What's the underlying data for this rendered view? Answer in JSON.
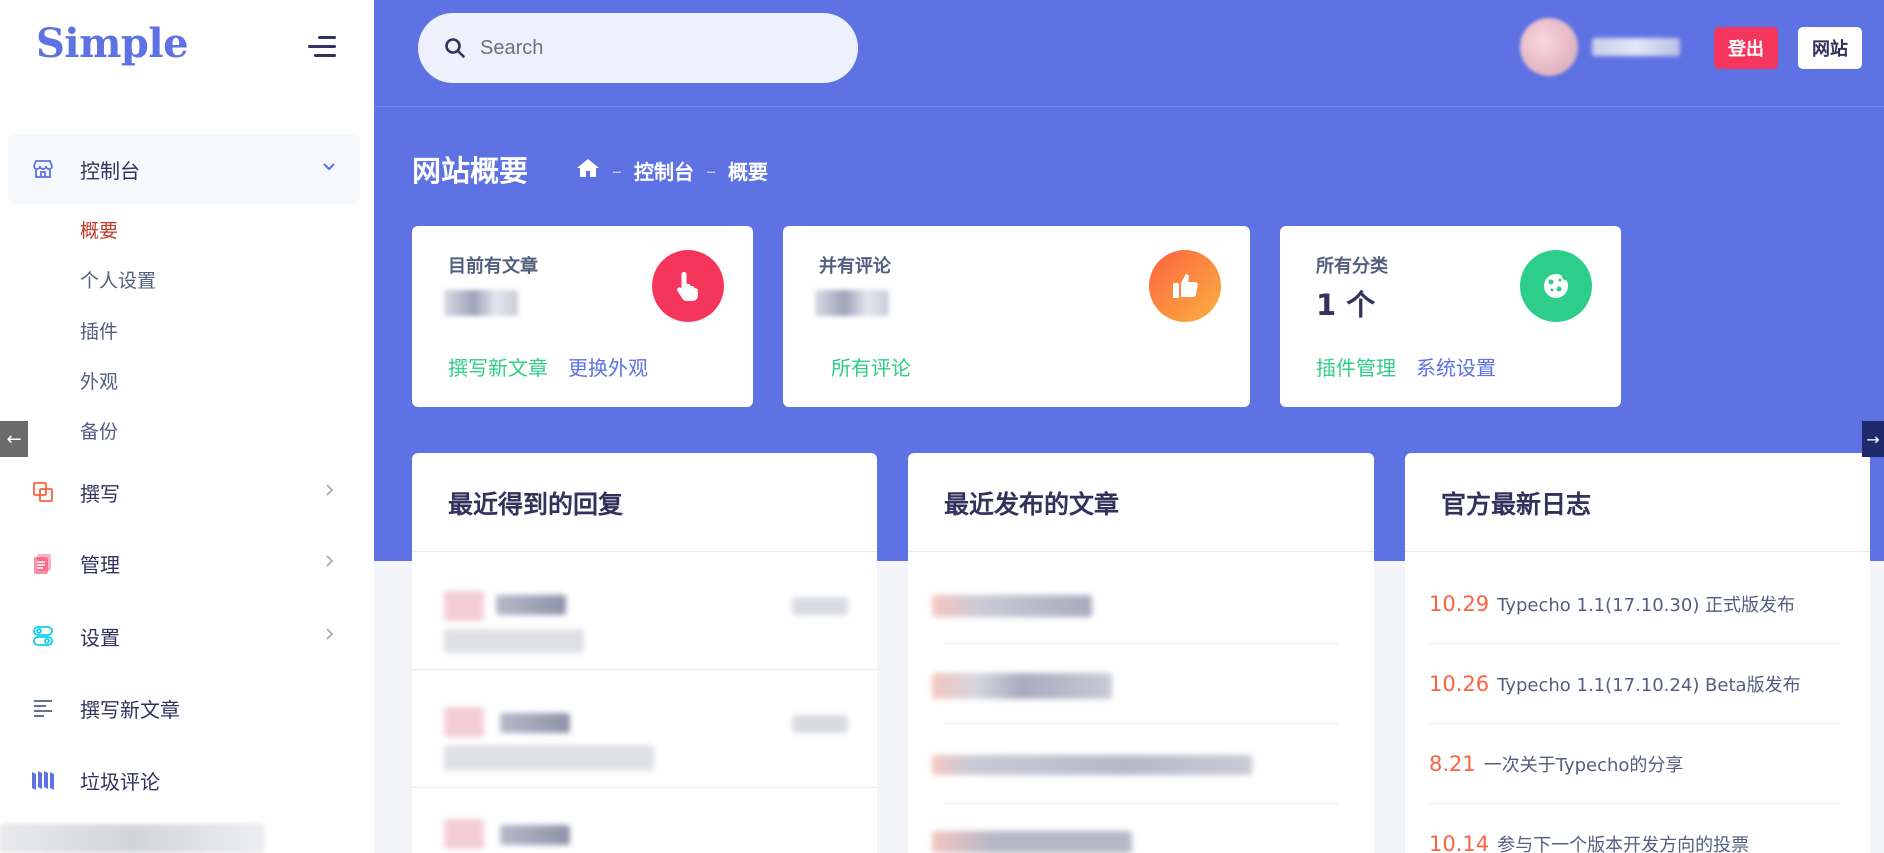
{
  "brand": {
    "logo": "Simple"
  },
  "search": {
    "placeholder": "Search"
  },
  "header": {
    "logout_label": "登出",
    "site_label": "网站"
  },
  "sidebar": {
    "items": [
      {
        "label": "控制台",
        "icon": "store-icon",
        "expanded": true
      },
      {
        "label": "撰写",
        "icon": "copy-icon"
      },
      {
        "label": "管理",
        "icon": "document-icon"
      },
      {
        "label": "设置",
        "icon": "settings-icon"
      },
      {
        "label": "撰写新文章",
        "icon": "align-left-icon"
      },
      {
        "label": "垃圾评论",
        "icon": "bars-icon"
      }
    ],
    "subitems": [
      "概要",
      "个人设置",
      "插件",
      "外观",
      "备份"
    ]
  },
  "page": {
    "title": "网站概要",
    "breadcrumb": [
      "控制台",
      "概要"
    ]
  },
  "stats": [
    {
      "title": "目前有文章",
      "links": [
        "撰写新文章",
        "更换外观"
      ],
      "icon": "pointer-hand-icon",
      "color": "#f5365c"
    },
    {
      "title": "并有评论",
      "links": [
        "所有评论"
      ],
      "icon": "thumbs-up-icon",
      "color": "#fb6340"
    },
    {
      "title": "所有分类",
      "value": "1 个",
      "links": [
        "插件管理",
        "系统设置"
      ],
      "icon": "cookie-icon",
      "color": "#2dce89"
    }
  ],
  "panels": {
    "replies_title": "最近得到的回复",
    "posts_title": "最近发布的文章",
    "logs_title": "官方最新日志"
  },
  "logs": [
    {
      "date": "10.29",
      "text": "Typecho 1.1(17.10.30) 正式版发布"
    },
    {
      "date": "10.26",
      "text": "Typecho 1.1(17.10.24) Beta版发布"
    },
    {
      "date": "8.21",
      "text": "一次关于Typecho的分享"
    },
    {
      "date": "10.14",
      "text": "参与下一个版本开发方向的投票"
    }
  ],
  "colors": {
    "primary": "#5e72e4",
    "danger": "#f5365c",
    "warning": "#fb6340",
    "success": "#2dce89"
  }
}
